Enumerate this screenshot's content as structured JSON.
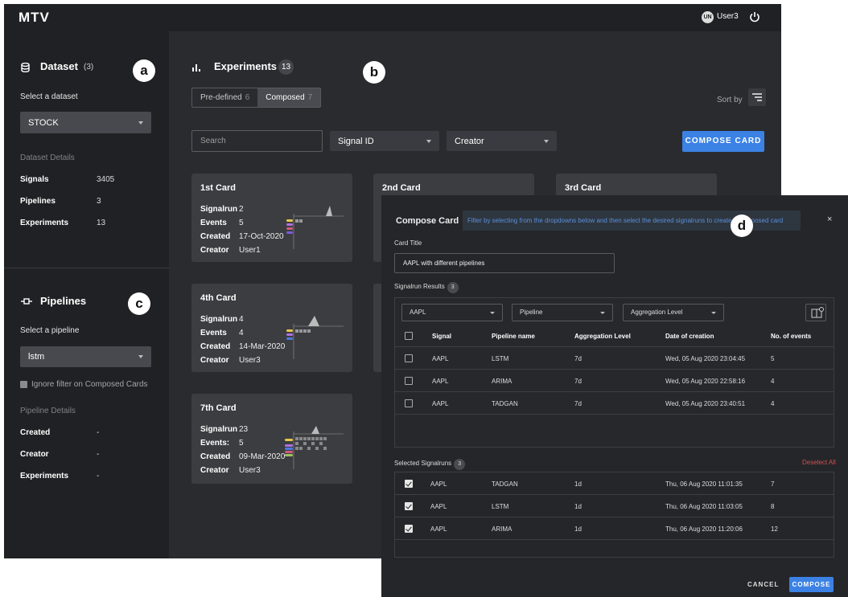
{
  "app": {
    "logo": "MTV",
    "user_initials": "UN",
    "user_name": "User3"
  },
  "sidebar": {
    "dataset": {
      "title": "Dataset",
      "count": "(3)",
      "tag": "a",
      "select_label": "Select a dataset",
      "selected": "STOCK",
      "details_label": "Dataset Details",
      "details": [
        {
          "key": "Signals",
          "value": "3405"
        },
        {
          "key": "Pipelines",
          "value": "3"
        },
        {
          "key": "Experiments",
          "value": "13"
        }
      ]
    },
    "pipelines": {
      "title": "Pipelines",
      "tag": "c",
      "select_label": "Select a pipeline",
      "selected": "lstm",
      "ignore_filter": "Ignore filter on Composed Cards",
      "details_label": "Pipeline Details",
      "details": [
        {
          "key": "Created",
          "value": "-"
        },
        {
          "key": "Creator",
          "value": "-"
        },
        {
          "key": "Experiments",
          "value": "-"
        }
      ]
    }
  },
  "main": {
    "title": "Experiments",
    "count": "13",
    "tag": "b",
    "tabs": [
      {
        "label": "Pre-defined",
        "count": "6"
      },
      {
        "label": "Composed",
        "count": "7"
      }
    ],
    "sort_label": "Sort by",
    "search_placeholder": "Search",
    "filter_signal": "Signal ID",
    "filter_creator": "Creator",
    "compose_btn": "COMPOSE CARD",
    "cards": [
      {
        "title": "1st Card",
        "rows": [
          {
            "k": "Signalrun",
            "v": "2"
          },
          {
            "k": "Events",
            "v": "5"
          },
          {
            "k": "Created",
            "v": "17-Oct-2020"
          },
          {
            "k": "Creator",
            "v": "User1"
          }
        ]
      },
      {
        "title": "2nd Card"
      },
      {
        "title": "3rd Card"
      },
      {
        "title": "4th Card",
        "rows": [
          {
            "k": "Signalrun",
            "v": "4"
          },
          {
            "k": "Events",
            "v": "4"
          },
          {
            "k": "Created",
            "v": "14-Mar-2020"
          },
          {
            "k": "Creator",
            "v": "User3"
          }
        ]
      },
      {
        "title": "7th Card",
        "rows": [
          {
            "k": "Signalrun",
            "v": "23"
          },
          {
            "k": "Events:",
            "v": "5"
          },
          {
            "k": "Created",
            "v": "09-Mar-2020"
          },
          {
            "k": "Creator",
            "v": "User3"
          }
        ]
      }
    ]
  },
  "modal": {
    "title": "Compose Card",
    "info": "Filter by selecting from the dropdowns below and then select the desired signalruns to create a composed card",
    "tag": "d",
    "close": "×",
    "card_title_label": "Card Title",
    "card_title_value": "AAPL with different pipelines",
    "results_label": "Signalrun Results",
    "results_count": "3",
    "filters": {
      "signal": "AAPL",
      "pipeline": "Pipeline",
      "aggregation": "Aggregation Level"
    },
    "columns": [
      "Signal",
      "Pipeline name",
      "Aggregation Level",
      "Date of creation",
      "No. of events"
    ],
    "results": [
      {
        "signal": "AAPL",
        "pipeline": "LSTM",
        "agg": "7d",
        "date": "Wed, 05 Aug 2020 23:04:45",
        "events": "5"
      },
      {
        "signal": "AAPL",
        "pipeline": "ARIMA",
        "agg": "7d",
        "date": "Wed, 05 Aug 2020 22:58:16",
        "events": "4"
      },
      {
        "signal": "AAPL",
        "pipeline": "TADGAN",
        "agg": "7d",
        "date": "Wed, 05 Aug 2020 23:40:51",
        "events": "4"
      }
    ],
    "selected_label": "Selected Signalruns",
    "selected_count": "3",
    "deselect_all": "Deselect All",
    "selected": [
      {
        "signal": "AAPL",
        "pipeline": "TADGAN",
        "agg": "1d",
        "date": "Thu, 06 Aug 2020 11:01:35",
        "events": "7"
      },
      {
        "signal": "AAPL",
        "pipeline": "LSTM",
        "agg": "1d",
        "date": "Thu, 06 Aug 2020 11:03:05",
        "events": "8"
      },
      {
        "signal": "AAPL",
        "pipeline": "ARIMA",
        "agg": "1d",
        "date": "Thu, 06 Aug 2020 11:20:06",
        "events": "12"
      }
    ],
    "cancel": "CANCEL",
    "compose": "COMPOSE"
  }
}
